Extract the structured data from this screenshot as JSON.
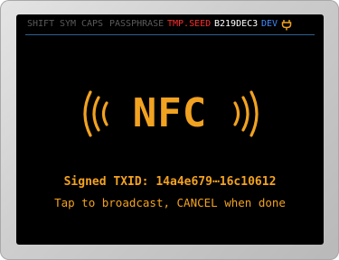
{
  "status_bar": {
    "shift": "SHIFT",
    "sym": "SYM",
    "caps": "CAPS",
    "passphrase": "PASSPHRASE",
    "tmp_seed": "TMP.SEED",
    "seed_id": "B219DEC3",
    "dev": "DEV",
    "power_icon": "plug-icon"
  },
  "main": {
    "nfc_label": "NFC",
    "txid_line": "Signed TXID: 14a4e679⋯16c10612",
    "instruction": "Tap to broadcast, CANCEL when done"
  },
  "colors": {
    "accent": "#f2a221",
    "screen": "#000000",
    "tmp_seed": "#ff2a2a",
    "dev": "#3f8cff",
    "inactive": "#5a5a5a",
    "power": "#f2a221"
  }
}
